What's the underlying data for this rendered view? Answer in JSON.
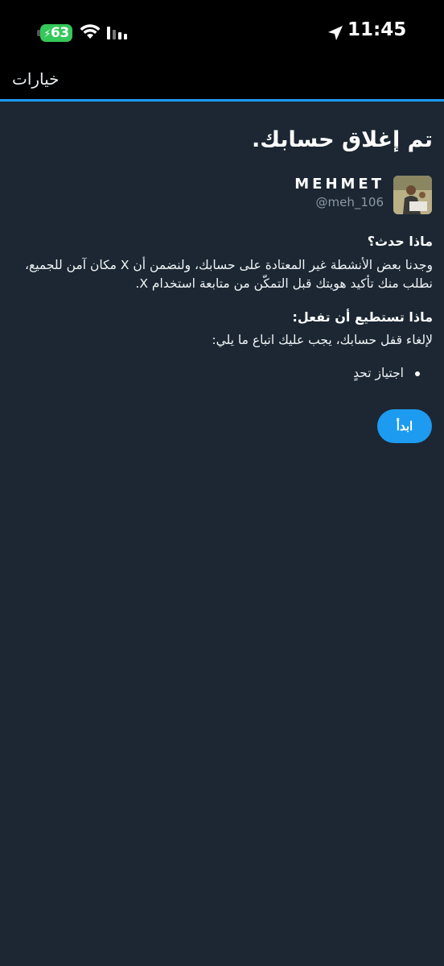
{
  "status_bar": {
    "battery": "63",
    "time": "11:45",
    "icons": [
      "battery-charging-icon",
      "wifi-icon",
      "signal-icon",
      "location-arrow-icon"
    ]
  },
  "nav": {
    "options_label": "خيارات"
  },
  "main": {
    "title": "تم إغلاق حسابك.",
    "account": {
      "display_name": "MEHMET",
      "username": "@meh_106"
    },
    "what_happened": {
      "heading": "ماذا حدث؟",
      "body": "وجدنا بعض الأنشطة غير المعتادة على حسابك، ولنضمن أن X مكان آمن للجميع، نطلب منك تأكيد هويتك قبل التمكّن من متابعة استخدام X."
    },
    "what_to_do": {
      "heading": "ماذا تستطيع أن تفعل:",
      "body": "لإلغاء قفل حسابك، يجب عليك اتباع ما يلي:",
      "steps": [
        "اجتياز تحدٍ"
      ]
    },
    "start_button": "ابدأ"
  },
  "colors": {
    "background": "#1c2733",
    "accent": "#1d9bf0",
    "battery": "#34c759"
  }
}
